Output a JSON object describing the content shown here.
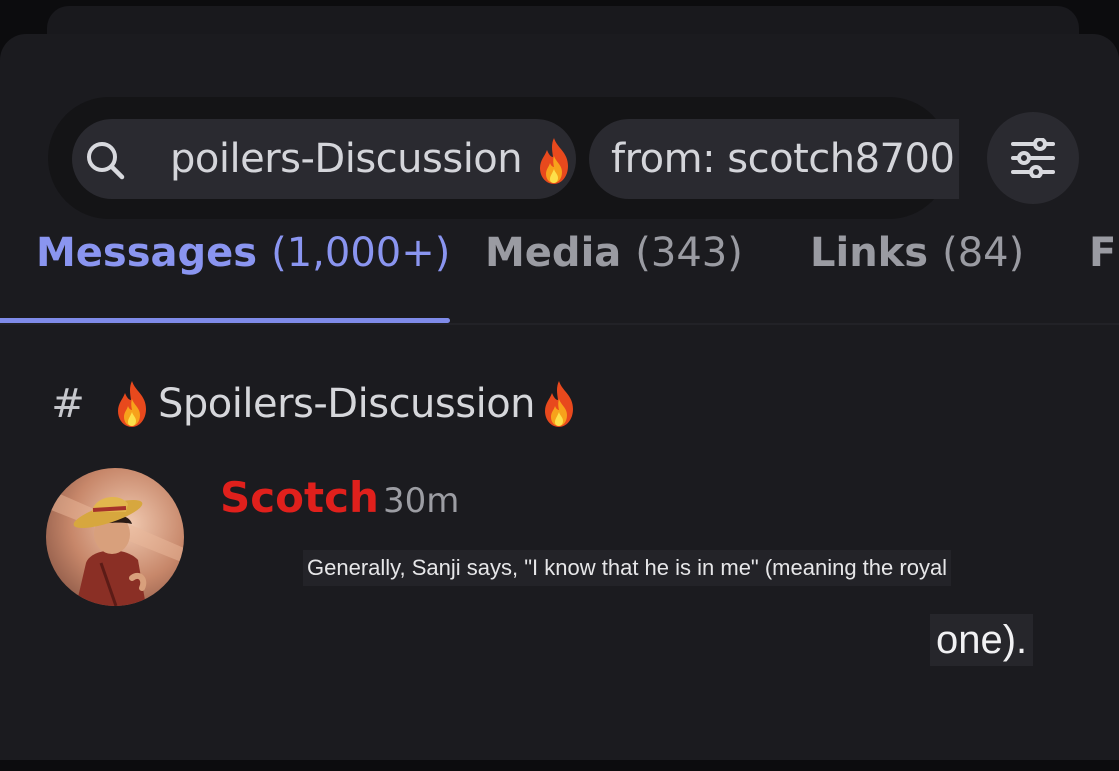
{
  "search": {
    "query": "poilers-Discussion",
    "from_filter": "from: scotch8700"
  },
  "tabs": [
    {
      "label": "Messages",
      "count": "(1,000+)",
      "active": true
    },
    {
      "label": "Media",
      "count": "(343)",
      "active": false
    },
    {
      "label": "Links",
      "count": "(84)",
      "active": false
    },
    {
      "label": "F",
      "count": "",
      "active": false
    }
  ],
  "result": {
    "channel_symbol": "#",
    "channel_name": "Spoilers-Discussion",
    "author": "Scotch",
    "time": "30m",
    "message_line1": "Generally, Sanji says, \"I know that he is in me\" (meaning the royal",
    "message_line2": "one)."
  },
  "icons": {
    "search": "search-icon",
    "filter": "sliders-icon",
    "fire": "fire-emoji-icon",
    "hash": "hash-icon"
  },
  "colors": {
    "accent": "#7f8be9",
    "author": "#e0201c",
    "background": "#1b1b1f"
  }
}
